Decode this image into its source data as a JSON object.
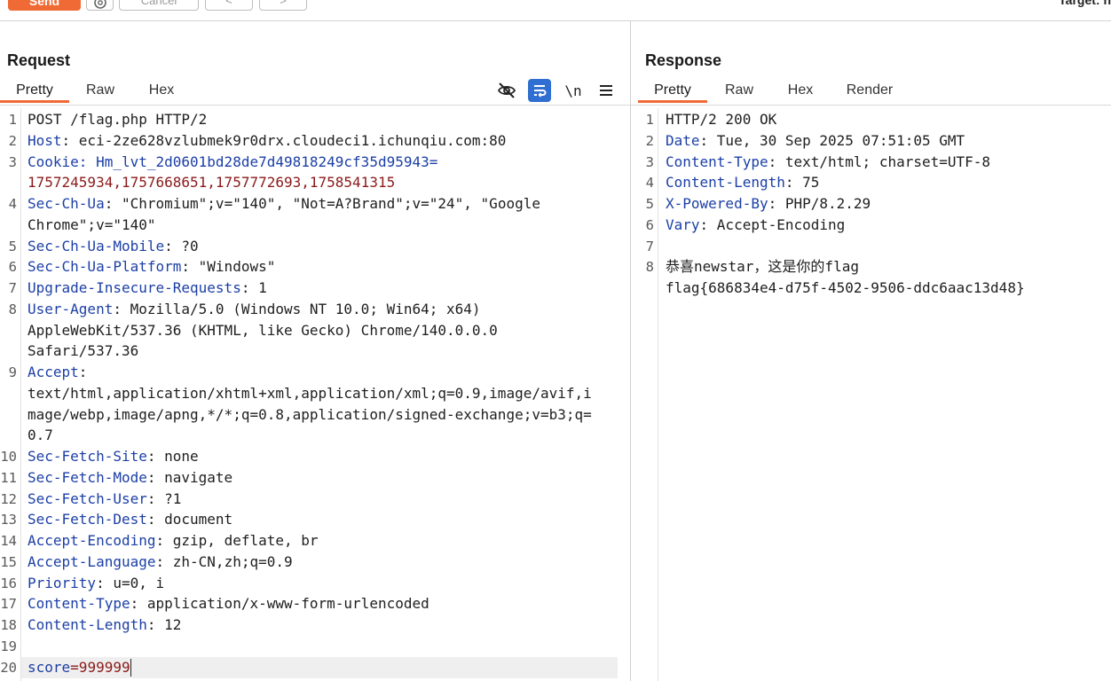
{
  "toolbar": {
    "send_label": "Send",
    "cancel_label": "Cancel",
    "prev_label": "<",
    "next_label": ">",
    "target_label": "Target: h"
  },
  "request": {
    "title": "Request",
    "tabs": [
      "Pretty",
      "Raw",
      "Hex"
    ],
    "active_tab": "Pretty",
    "icons": [
      "eye-off-icon",
      "wrap-icon",
      "newline-icon",
      "menu-icon"
    ],
    "newline_label": "\\n",
    "lines": [
      {
        "n": "1",
        "key": "",
        "rest": "POST /flag.php HTTP/2"
      },
      {
        "n": "2",
        "key": "Host",
        "rest": ": eci-2ze628vzlubmek9r0drx.cloudeci1.ichunqiu.com:80"
      },
      {
        "n": "3",
        "key": "Cookie",
        "rest": ": Hm_lvt_2d0601bd28de7d49818249cf35d95943="
      },
      {
        "n": "",
        "key": "",
        "rest": "1757245934,1757668651,1757772693,1758541315"
      },
      {
        "n": "4",
        "key": "Sec-Ch-Ua",
        "rest": ": \"Chromium\";v=\"140\", \"Not=A?Brand\";v=\"24\", \"Google"
      },
      {
        "n": "",
        "key": "",
        "rest": "Chrome\";v=\"140\""
      },
      {
        "n": "5",
        "key": "Sec-Ch-Ua-Mobile",
        "rest": ": ?0"
      },
      {
        "n": "6",
        "key": "Sec-Ch-Ua-Platform",
        "rest": ": \"Windows\""
      },
      {
        "n": "7",
        "key": "Upgrade-Insecure-Requests",
        "rest": ": 1"
      },
      {
        "n": "8",
        "key": "User-Agent",
        "rest": ": Mozilla/5.0 (Windows NT 10.0; Win64; x64)"
      },
      {
        "n": "",
        "key": "",
        "rest": "AppleWebKit/537.36 (KHTML, like Gecko) Chrome/140.0.0.0"
      },
      {
        "n": "",
        "key": "",
        "rest": "Safari/537.36"
      },
      {
        "n": "9",
        "key": "Accept",
        "rest": ":"
      },
      {
        "n": "",
        "key": "",
        "rest": "text/html,application/xhtml+xml,application/xml;q=0.9,image/avif,i"
      },
      {
        "n": "",
        "key": "",
        "rest": "mage/webp,image/apng,*/*;q=0.8,application/signed-exchange;v=b3;q="
      },
      {
        "n": "",
        "key": "",
        "rest": "0.7"
      },
      {
        "n": "10",
        "key": "Sec-Fetch-Site",
        "rest": ": none"
      },
      {
        "n": "11",
        "key": "Sec-Fetch-Mode",
        "rest": ": navigate"
      },
      {
        "n": "12",
        "key": "Sec-Fetch-User",
        "rest": ": ?1"
      },
      {
        "n": "13",
        "key": "Sec-Fetch-Dest",
        "rest": ": document"
      },
      {
        "n": "14",
        "key": "Accept-Encoding",
        "rest": ": gzip, deflate, br"
      },
      {
        "n": "15",
        "key": "Accept-Language",
        "rest": ": zh-CN,zh;q=0.9"
      },
      {
        "n": "16",
        "key": "Priority",
        "rest": ": u=0, i"
      },
      {
        "n": "17",
        "key": "Content-Type",
        "rest": ": application/x-www-form-urlencoded"
      },
      {
        "n": "18",
        "key": "Content-Length",
        "rest": ": 12"
      },
      {
        "n": "19",
        "key": "",
        "rest": ""
      },
      {
        "n": "20",
        "key": "score",
        "rest": "=999999"
      }
    ]
  },
  "response": {
    "title": "Response",
    "tabs": [
      "Pretty",
      "Raw",
      "Hex",
      "Render"
    ],
    "active_tab": "Pretty",
    "lines": [
      {
        "n": "1",
        "key": "",
        "rest": "HTTP/2 200 OK"
      },
      {
        "n": "2",
        "key": "Date",
        "rest": ": Tue, 30 Sep 2025 07:51:05 GMT"
      },
      {
        "n": "3",
        "key": "Content-Type",
        "rest": ": text/html; charset=UTF-8"
      },
      {
        "n": "4",
        "key": "Content-Length",
        "rest": ": 75"
      },
      {
        "n": "5",
        "key": "X-Powered-By",
        "rest": ": PHP/8.2.29"
      },
      {
        "n": "6",
        "key": "Vary",
        "rest": ": Accept-Encoding"
      },
      {
        "n": "7",
        "key": "",
        "rest": ""
      },
      {
        "n": "8",
        "key": "",
        "rest": "恭喜newstar，这是你的flag"
      },
      {
        "n": "",
        "key": "",
        "rest": "flag{686834e4-d75f-4502-9506-ddc6aac13d48}"
      }
    ]
  },
  "colors": {
    "accent": "#f06a35",
    "header_key": "#1c3fa6",
    "cookie_value": "#8b1a1a",
    "wrap_icon_bg": "#2f6fd1"
  }
}
